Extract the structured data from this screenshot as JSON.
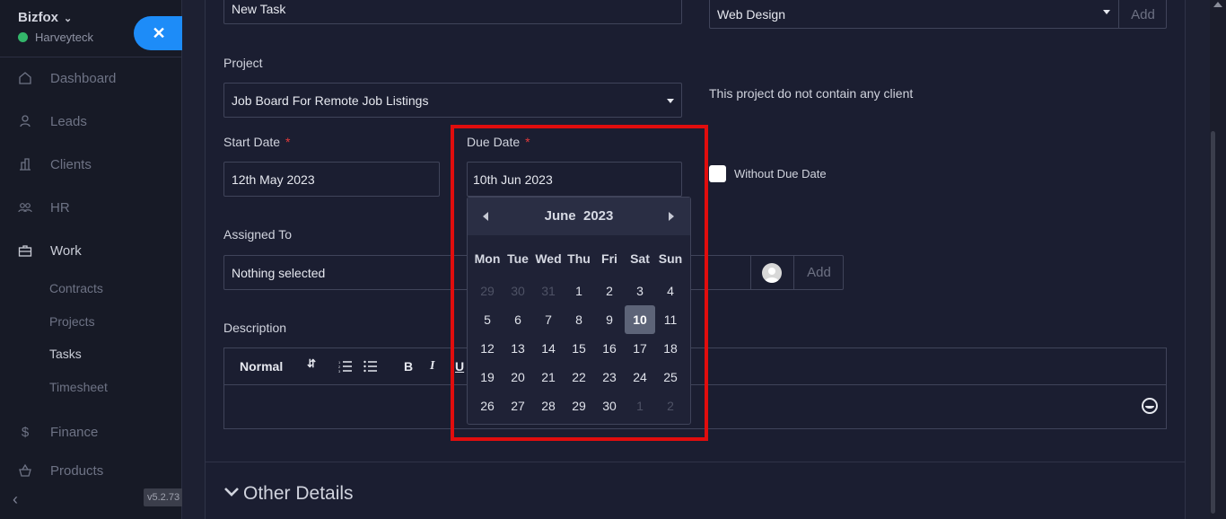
{
  "sidebar": {
    "brand": "Bizfox",
    "org": "Harveyteck",
    "close_label": "✕",
    "items": [
      {
        "label": "Dashboard"
      },
      {
        "label": "Leads"
      },
      {
        "label": "Clients"
      },
      {
        "label": "HR"
      },
      {
        "label": "Work"
      },
      {
        "label": "Finance"
      },
      {
        "label": "Products"
      }
    ],
    "work_sub": [
      {
        "label": "Contracts"
      },
      {
        "label": "Projects"
      },
      {
        "label": "Tasks"
      },
      {
        "label": "Timesheet"
      }
    ],
    "version": "v5.2.73"
  },
  "form": {
    "title_value": "New Task",
    "category_value": "Web Design",
    "category_add": "Add",
    "project_label": "Project",
    "project_value": "Job Board For Remote Job Listings",
    "project_note": "This project do not contain any client",
    "start_label": "Start Date",
    "start_value": "12th May 2023",
    "due_label": "Due Date",
    "due_value": "10th Jun 2023",
    "without_due": "Without Due Date",
    "assigned_label": "Assigned To",
    "assigned_value": "Nothing selected",
    "assigned_add": "Add",
    "description_label": "Description",
    "toolbar_format": "Normal",
    "other_details": "Other Details",
    "required_mark": "*"
  },
  "datepicker": {
    "month": "June",
    "year": "2023",
    "weekdays": [
      "Mon",
      "Tue",
      "Wed",
      "Thu",
      "Fri",
      "Sat",
      "Sun"
    ],
    "weeks": [
      [
        "29",
        "30",
        "31",
        "1",
        "2",
        "3",
        "4"
      ],
      [
        "5",
        "6",
        "7",
        "8",
        "9",
        "10",
        "11"
      ],
      [
        "12",
        "13",
        "14",
        "15",
        "16",
        "17",
        "18"
      ],
      [
        "19",
        "20",
        "21",
        "22",
        "23",
        "24",
        "25"
      ],
      [
        "26",
        "27",
        "28",
        "29",
        "30",
        "1",
        "2"
      ]
    ],
    "selected": "10"
  }
}
